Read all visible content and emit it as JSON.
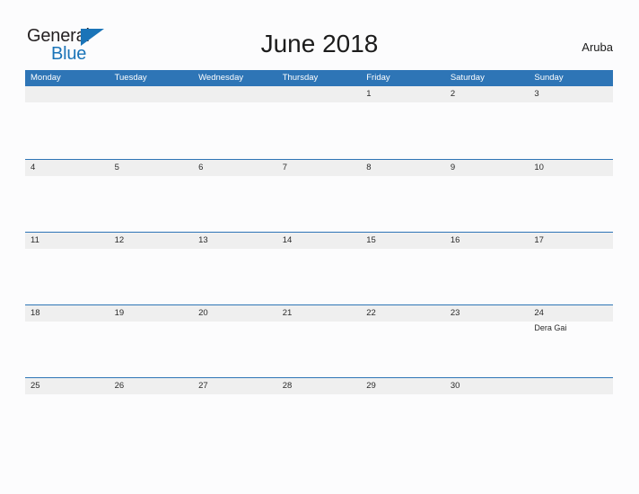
{
  "brand": {
    "name_part1": "General",
    "name_part2": "Blue",
    "triangle_color": "#1a74b8"
  },
  "header": {
    "title": "June 2018",
    "country": "Aruba",
    "accent_color": "#2e75b6",
    "band_color": "#efefef"
  },
  "calendar": {
    "weekdays": [
      "Monday",
      "Tuesday",
      "Wednesday",
      "Thursday",
      "Friday",
      "Saturday",
      "Sunday"
    ],
    "weeks": [
      [
        {
          "day": "",
          "events": []
        },
        {
          "day": "",
          "events": []
        },
        {
          "day": "",
          "events": []
        },
        {
          "day": "",
          "events": []
        },
        {
          "day": "1",
          "events": []
        },
        {
          "day": "2",
          "events": []
        },
        {
          "day": "3",
          "events": []
        }
      ],
      [
        {
          "day": "4",
          "events": []
        },
        {
          "day": "5",
          "events": []
        },
        {
          "day": "6",
          "events": []
        },
        {
          "day": "7",
          "events": []
        },
        {
          "day": "8",
          "events": []
        },
        {
          "day": "9",
          "events": []
        },
        {
          "day": "10",
          "events": []
        }
      ],
      [
        {
          "day": "11",
          "events": []
        },
        {
          "day": "12",
          "events": []
        },
        {
          "day": "13",
          "events": []
        },
        {
          "day": "14",
          "events": []
        },
        {
          "day": "15",
          "events": []
        },
        {
          "day": "16",
          "events": []
        },
        {
          "day": "17",
          "events": []
        }
      ],
      [
        {
          "day": "18",
          "events": []
        },
        {
          "day": "19",
          "events": []
        },
        {
          "day": "20",
          "events": []
        },
        {
          "day": "21",
          "events": []
        },
        {
          "day": "22",
          "events": []
        },
        {
          "day": "23",
          "events": []
        },
        {
          "day": "24",
          "events": [
            "Dera Gai"
          ]
        }
      ],
      [
        {
          "day": "25",
          "events": []
        },
        {
          "day": "26",
          "events": []
        },
        {
          "day": "27",
          "events": []
        },
        {
          "day": "28",
          "events": []
        },
        {
          "day": "29",
          "events": []
        },
        {
          "day": "30",
          "events": []
        },
        {
          "day": "",
          "events": []
        }
      ]
    ]
  }
}
